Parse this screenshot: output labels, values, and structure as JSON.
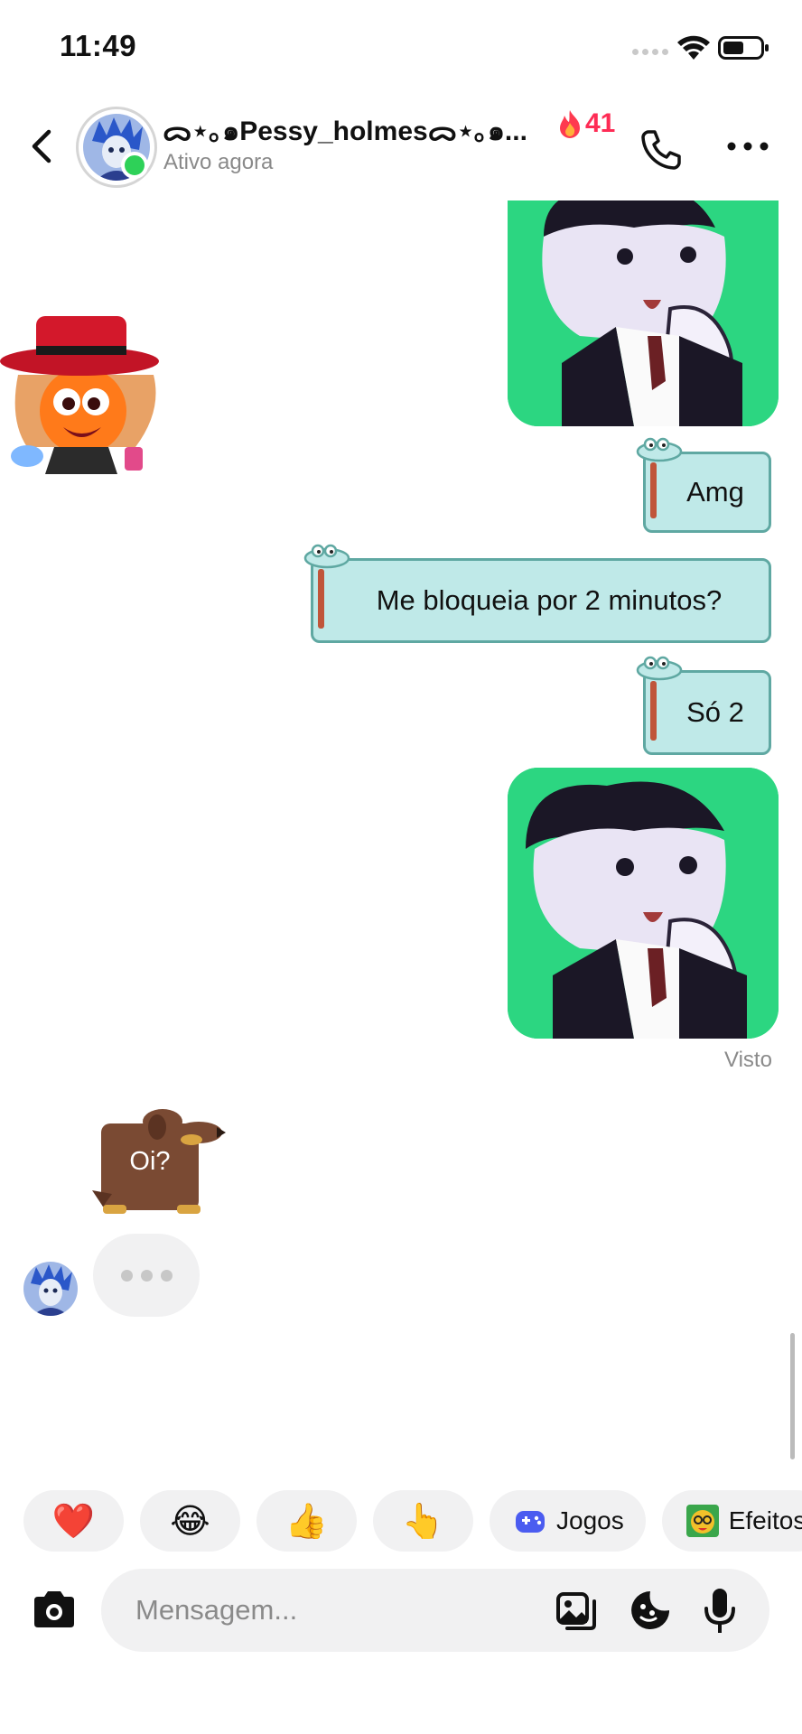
{
  "status_bar": {
    "time": "11:49"
  },
  "header": {
    "contact_name": "ᯅ⋆｡๑Pessy_holmesᯅ⋆｡๑...",
    "status": "Ativo agora",
    "streak_count": "41",
    "online": true
  },
  "messages": [
    {
      "side": "right",
      "type": "image",
      "subject": "cartoon boy in vest"
    },
    {
      "side": "left",
      "type": "sticker",
      "subject": "orange character with red hat"
    },
    {
      "side": "right",
      "type": "text",
      "text": "Amg"
    },
    {
      "side": "right",
      "type": "text",
      "text": "Me bloqueia por 2 minutos?"
    },
    {
      "side": "right",
      "type": "text",
      "text": "Só 2"
    },
    {
      "side": "right",
      "type": "image",
      "subject": "cartoon boy in vest"
    },
    {
      "side": "left",
      "type": "sticker",
      "subject": "brown dog",
      "text": "Oi?"
    }
  ],
  "seen_label": "Visto",
  "typing_indicator": true,
  "quick_reactions": {
    "emojis": [
      "❤️",
      "😂",
      "👍",
      "👆"
    ],
    "games_label": "Jogos",
    "effects_label": "Efeitos"
  },
  "composer": {
    "placeholder": "Mensagem..."
  },
  "colors": {
    "online": "#2ed158",
    "streak": "#fe2c55",
    "bubble_fill": "#bfe9e8",
    "bubble_border": "#5fa8a2",
    "image_bg": "#2cd681",
    "chip_bg": "#f1f1f2"
  }
}
